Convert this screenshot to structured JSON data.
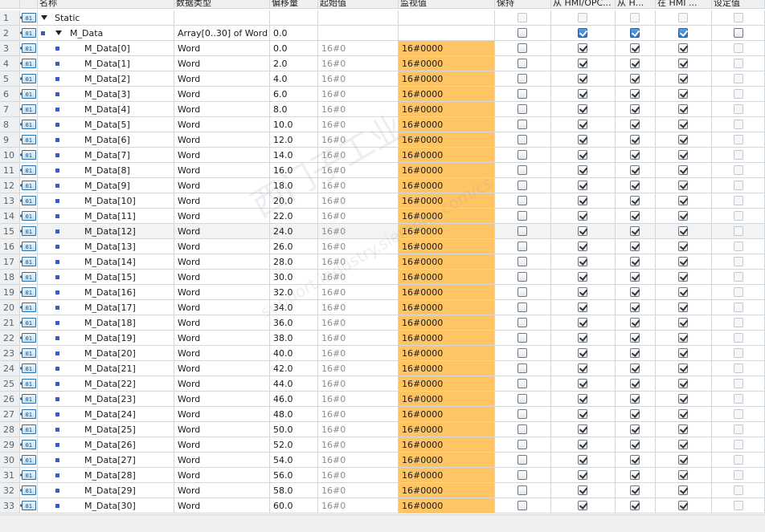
{
  "columns": {
    "name": "名称",
    "datatype": "数据类型",
    "offset": "偏移量",
    "start": "起始值",
    "monitor": "监视值",
    "retain": "保持",
    "from_hmi_opc": "从 HMI/OPC...",
    "from_h": "从 H...",
    "in_hmi": "在 HMI ...",
    "setpoint": "设定值"
  },
  "static_row": {
    "num": "1",
    "name": "Static"
  },
  "array_row": {
    "num": "2",
    "name": "M_Data",
    "datatype": "Array[0..30] of Word",
    "offset": "0.0"
  },
  "elements": [
    {
      "num": "3",
      "name": "M_Data[0]",
      "type": "Word",
      "offset": "0.0",
      "start": "16#0",
      "monitor": "16#0000"
    },
    {
      "num": "4",
      "name": "M_Data[1]",
      "type": "Word",
      "offset": "2.0",
      "start": "16#0",
      "monitor": "16#0000"
    },
    {
      "num": "5",
      "name": "M_Data[2]",
      "type": "Word",
      "offset": "4.0",
      "start": "16#0",
      "monitor": "16#0000"
    },
    {
      "num": "6",
      "name": "M_Data[3]",
      "type": "Word",
      "offset": "6.0",
      "start": "16#0",
      "monitor": "16#0000"
    },
    {
      "num": "7",
      "name": "M_Data[4]",
      "type": "Word",
      "offset": "8.0",
      "start": "16#0",
      "monitor": "16#0000"
    },
    {
      "num": "8",
      "name": "M_Data[5]",
      "type": "Word",
      "offset": "10.0",
      "start": "16#0",
      "monitor": "16#0000"
    },
    {
      "num": "9",
      "name": "M_Data[6]",
      "type": "Word",
      "offset": "12.0",
      "start": "16#0",
      "monitor": "16#0000"
    },
    {
      "num": "10",
      "name": "M_Data[7]",
      "type": "Word",
      "offset": "14.0",
      "start": "16#0",
      "monitor": "16#0000"
    },
    {
      "num": "11",
      "name": "M_Data[8]",
      "type": "Word",
      "offset": "16.0",
      "start": "16#0",
      "monitor": "16#0000"
    },
    {
      "num": "12",
      "name": "M_Data[9]",
      "type": "Word",
      "offset": "18.0",
      "start": "16#0",
      "monitor": "16#0000"
    },
    {
      "num": "13",
      "name": "M_Data[10]",
      "type": "Word",
      "offset": "20.0",
      "start": "16#0",
      "monitor": "16#0000"
    },
    {
      "num": "14",
      "name": "M_Data[11]",
      "type": "Word",
      "offset": "22.0",
      "start": "16#0",
      "monitor": "16#0000"
    },
    {
      "num": "15",
      "name": "M_Data[12]",
      "type": "Word",
      "offset": "24.0",
      "start": "16#0",
      "monitor": "16#0000"
    },
    {
      "num": "16",
      "name": "M_Data[13]",
      "type": "Word",
      "offset": "26.0",
      "start": "16#0",
      "monitor": "16#0000"
    },
    {
      "num": "17",
      "name": "M_Data[14]",
      "type": "Word",
      "offset": "28.0",
      "start": "16#0",
      "monitor": "16#0000"
    },
    {
      "num": "18",
      "name": "M_Data[15]",
      "type": "Word",
      "offset": "30.0",
      "start": "16#0",
      "monitor": "16#0000"
    },
    {
      "num": "19",
      "name": "M_Data[16]",
      "type": "Word",
      "offset": "32.0",
      "start": "16#0",
      "monitor": "16#0000"
    },
    {
      "num": "20",
      "name": "M_Data[17]",
      "type": "Word",
      "offset": "34.0",
      "start": "16#0",
      "monitor": "16#0000"
    },
    {
      "num": "21",
      "name": "M_Data[18]",
      "type": "Word",
      "offset": "36.0",
      "start": "16#0",
      "monitor": "16#0000"
    },
    {
      "num": "22",
      "name": "M_Data[19]",
      "type": "Word",
      "offset": "38.0",
      "start": "16#0",
      "monitor": "16#0000"
    },
    {
      "num": "23",
      "name": "M_Data[20]",
      "type": "Word",
      "offset": "40.0",
      "start": "16#0",
      "monitor": "16#0000"
    },
    {
      "num": "24",
      "name": "M_Data[21]",
      "type": "Word",
      "offset": "42.0",
      "start": "16#0",
      "monitor": "16#0000"
    },
    {
      "num": "25",
      "name": "M_Data[22]",
      "type": "Word",
      "offset": "44.0",
      "start": "16#0",
      "monitor": "16#0000"
    },
    {
      "num": "26",
      "name": "M_Data[23]",
      "type": "Word",
      "offset": "46.0",
      "start": "16#0",
      "monitor": "16#0000"
    },
    {
      "num": "27",
      "name": "M_Data[24]",
      "type": "Word",
      "offset": "48.0",
      "start": "16#0",
      "monitor": "16#0000"
    },
    {
      "num": "28",
      "name": "M_Data[25]",
      "type": "Word",
      "offset": "50.0",
      "start": "16#0",
      "monitor": "16#0000"
    },
    {
      "num": "29",
      "name": "M_Data[26]",
      "type": "Word",
      "offset": "52.0",
      "start": "16#0",
      "monitor": "16#0000"
    },
    {
      "num": "30",
      "name": "M_Data[27]",
      "type": "Word",
      "offset": "54.0",
      "start": "16#0",
      "monitor": "16#0000"
    },
    {
      "num": "31",
      "name": "M_Data[28]",
      "type": "Word",
      "offset": "56.0",
      "start": "16#0",
      "monitor": "16#0000"
    },
    {
      "num": "32",
      "name": "M_Data[29]",
      "type": "Word",
      "offset": "58.0",
      "start": "16#0",
      "monitor": "16#0000"
    },
    {
      "num": "33",
      "name": "M_Data[30]",
      "type": "Word",
      "offset": "60.0",
      "start": "16#0",
      "monitor": "16#0000"
    }
  ],
  "watermark": {
    "text": "西门子工业",
    "sub": "support.industry.siemens.com/cs"
  },
  "colors": {
    "monitor_bg": "#ffc464",
    "highlight_row": "#f2f3f4",
    "checkbox_blue": "#2f73c9"
  }
}
